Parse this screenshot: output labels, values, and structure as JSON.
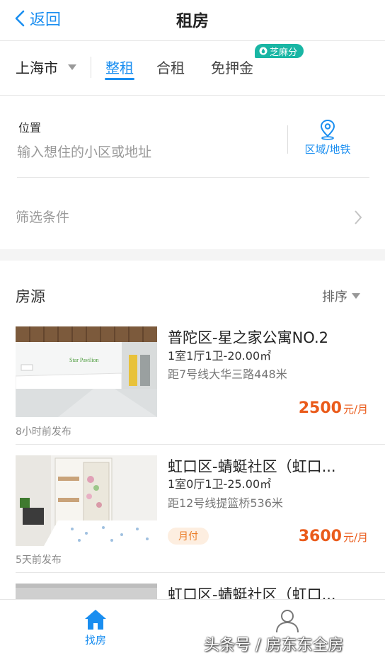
{
  "header": {
    "back_label": "返回",
    "title": "租房"
  },
  "tabs_row": {
    "city": "上海市",
    "tabs": [
      {
        "label": "整租",
        "active": true
      },
      {
        "label": "合租",
        "active": false
      },
      {
        "label": "免押金",
        "active": false
      }
    ],
    "badge": "芝麻分"
  },
  "location": {
    "label": "位置",
    "placeholder": "输入想住的小区或地址",
    "area_button": "区域/地铁"
  },
  "filter": {
    "label": "筛选条件"
  },
  "listings_header": {
    "title": "房源",
    "sort_label": "排序"
  },
  "listings": [
    {
      "title": "普陀区-星之家公寓NO.2",
      "spec": "1室1厅1卫-20.00㎡",
      "distance": "距7号线大华三路448米",
      "price": "2500",
      "price_unit": "元/月",
      "posted": "8小时前发布",
      "photo_sign": "Star Pavilion"
    },
    {
      "title": "虹口区-蜻蜓社区（虹口...",
      "spec": "1室0厅1卫-25.00㎡",
      "distance": "距12号线提篮桥536米",
      "price": "3600",
      "price_unit": "元/月",
      "posted": "5天前发布",
      "tag": "月付"
    },
    {
      "title": "虹口区-蜻蜓社区（虹口..."
    }
  ],
  "bottom_nav": {
    "find_label": "找房"
  },
  "watermark": "头条号 / 房东东全房",
  "colors": {
    "accent": "#1a8ef0",
    "price": "#ea5b1b",
    "badge": "#19b6a4"
  }
}
